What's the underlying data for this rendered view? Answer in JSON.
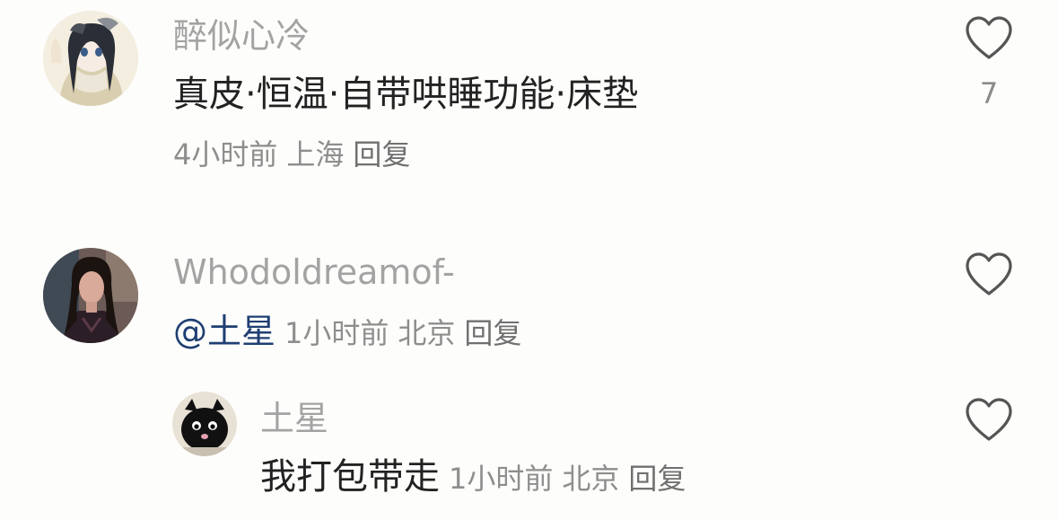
{
  "comments": [
    {
      "username": "醉似心冷",
      "content": "真皮·恒温·自带哄睡功能·床垫",
      "time": "4小时前",
      "location": "上海",
      "reply_label": "回复",
      "like_count": "7"
    },
    {
      "username": "Whodoldreamof-",
      "mention": "@土星",
      "time": "1小时前",
      "location": "北京",
      "reply_label": "回复"
    },
    {
      "username": "土星",
      "content": "我打包带走",
      "time": "1小时前",
      "location": "北京",
      "reply_label": "回复"
    }
  ],
  "colors": {
    "username": "#a3a3a3",
    "content": "#222222",
    "meta": "#8e8e8e",
    "mention": "#1f3f73",
    "heart_outline": "#555555"
  },
  "icons": {
    "like": "heart-outline-icon"
  }
}
